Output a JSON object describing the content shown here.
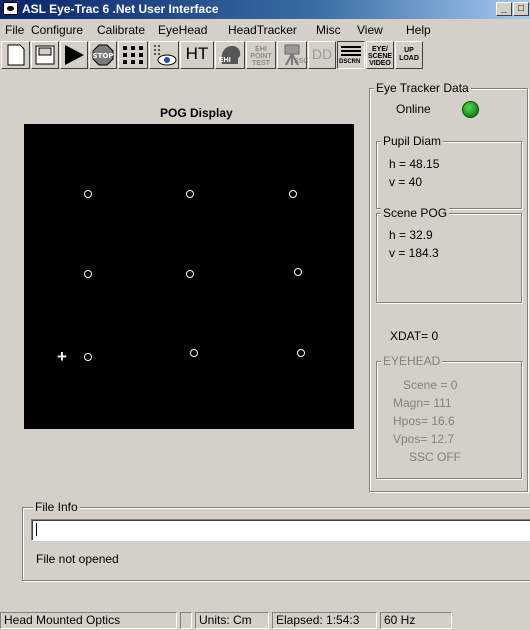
{
  "window": {
    "title": "ASL Eye-Trac 6 .Net User Interface"
  },
  "menu": [
    "File",
    "Configure",
    "Calibrate",
    "EyeHead",
    "HeadTracker",
    "Misc",
    "View",
    "Help"
  ],
  "toolbar": {
    "ht_label": "HT",
    "ehi_label": "EHI",
    "ehi_point_test_label": "EHI\nPOINT\nTEST",
    "ssc_label": "SSC",
    "dd_label": "DD",
    "dscrn_label": "DSCRN",
    "eye_scene_video_label": "EYE/\nSCENE\nVIDEO",
    "upload_label": "UP\nLOAD"
  },
  "pog": {
    "title": "POG Display",
    "cursor": "+"
  },
  "eye_tracker": {
    "title": "Eye Tracker Data",
    "status": "Online",
    "status_color": "#1ea01e",
    "pupil_diam": {
      "title": "Pupil Diam",
      "h": "h =  48.15",
      "v": "v =  40"
    },
    "scene_pog": {
      "title": "Scene POG",
      "h": "h =  32.9",
      "v": "v =  184.3"
    },
    "xdat": "XDAT=  0",
    "eyehead": {
      "title": "EYEHEAD",
      "scene": "Scene =  0",
      "magn": "Magn=  111",
      "hpos": "Hpos=  16.6",
      "vpos": "Vpos=  12.7",
      "ssc": "SSC OFF"
    }
  },
  "file_info": {
    "title": "File Info",
    "value": "",
    "status": "File not opened"
  },
  "statusbar": [
    "Head  Mounted  Optics",
    "",
    "Units: Cm",
    "Elapsed: 1:54:3",
    "60 Hz"
  ]
}
